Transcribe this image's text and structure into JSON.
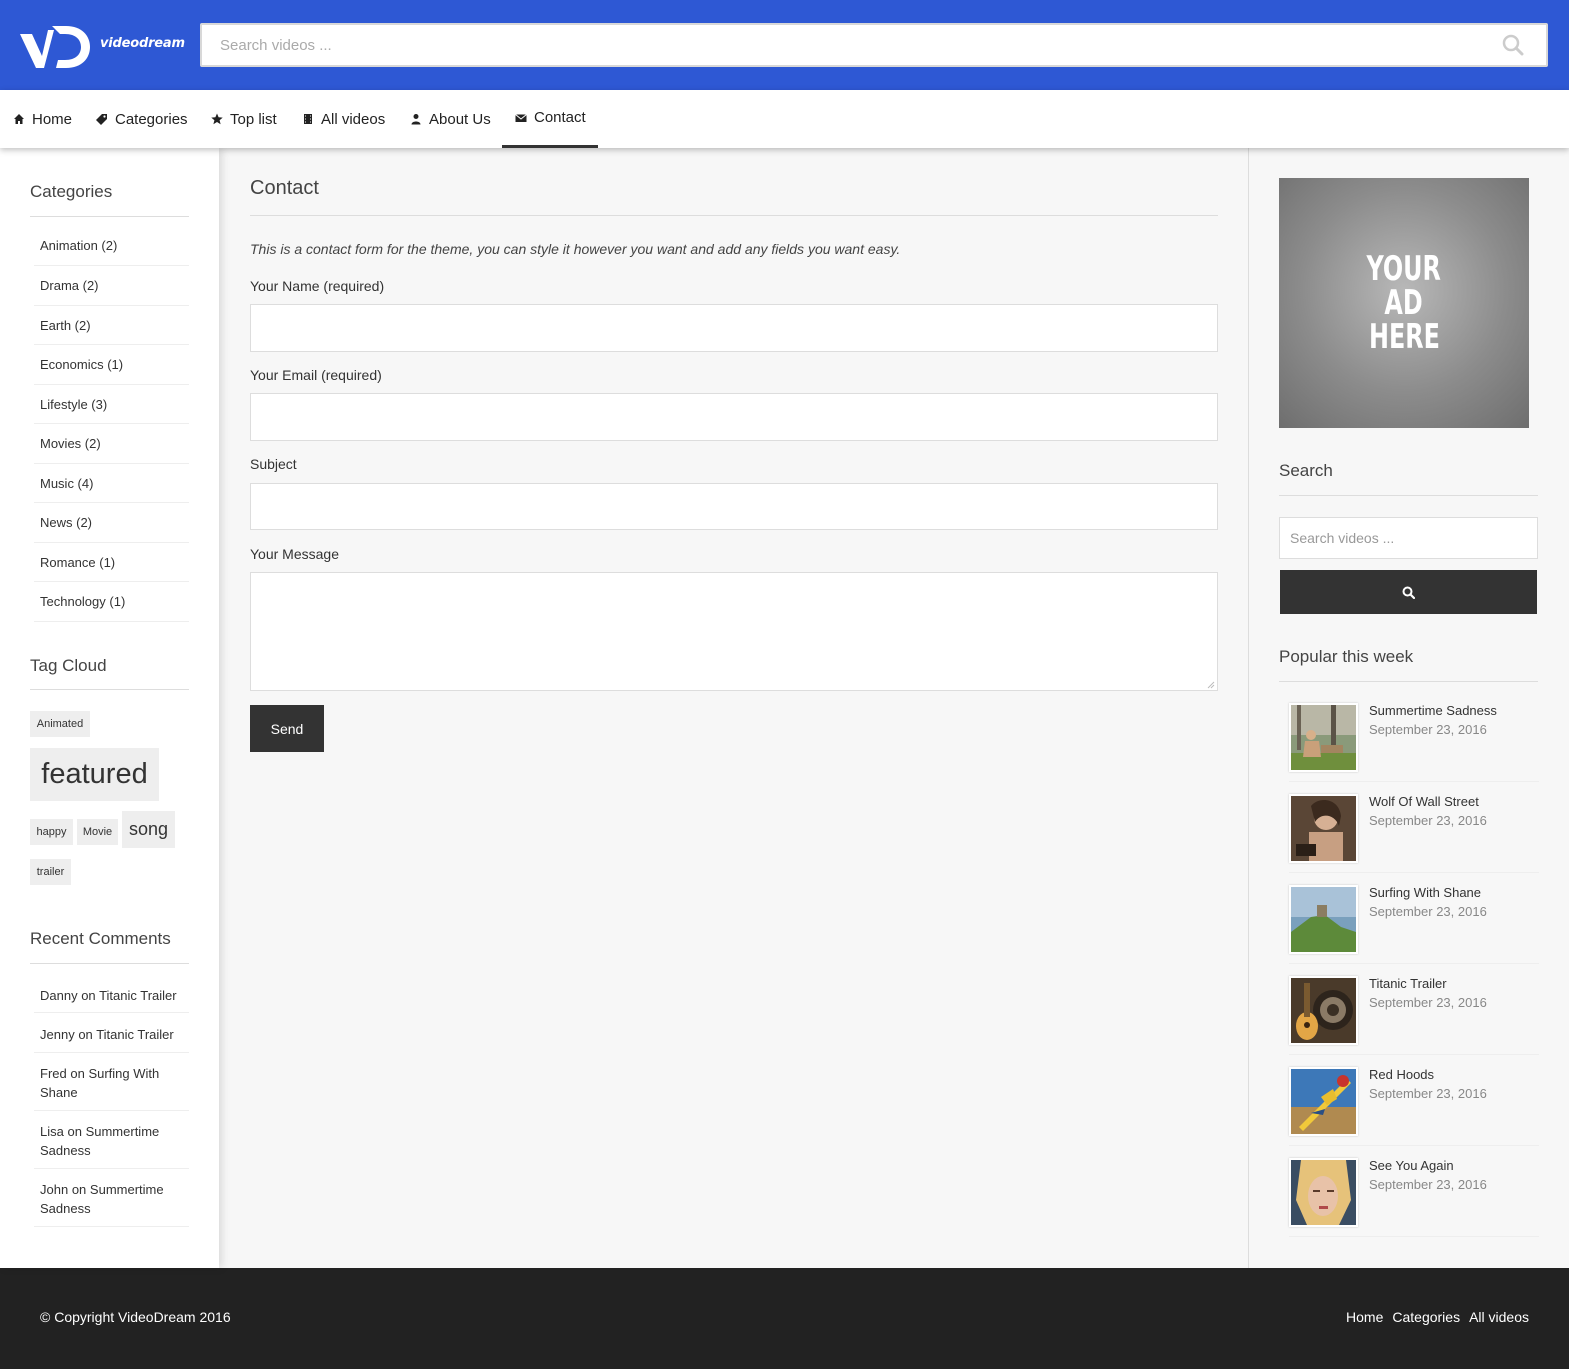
{
  "header": {
    "brand": "videodream",
    "search_placeholder": "Search videos ..."
  },
  "nav": [
    {
      "label": "Home",
      "icon": "home-icon"
    },
    {
      "label": "Categories",
      "icon": "tag-icon"
    },
    {
      "label": "Top list",
      "icon": "star-icon"
    },
    {
      "label": "All videos",
      "icon": "film-icon"
    },
    {
      "label": "About Us",
      "icon": "user-icon"
    },
    {
      "label": "Contact",
      "icon": "envelope-icon",
      "active": true
    }
  ],
  "left_sidebar": {
    "categories_title": "Categories",
    "categories": [
      "Animation (2)",
      "Drama (2)",
      "Earth (2)",
      "Economics (1)",
      "Lifestyle (3)",
      "Movies (2)",
      "Music (4)",
      "News (2)",
      "Romance (1)",
      "Technology (1)"
    ],
    "tag_cloud_title": "Tag Cloud",
    "tags": [
      "Animated",
      "featured",
      "happy",
      "Movie",
      "song",
      "trailer"
    ],
    "recent_comments_title": "Recent Comments",
    "recent_comments": [
      {
        "author": "Danny",
        "on": "on",
        "post": "Titanic Trailer"
      },
      {
        "author": "Jenny",
        "on": "on",
        "post": "Titanic Trailer"
      },
      {
        "author": "Fred",
        "on": "on",
        "post": "Surfing With Shane"
      },
      {
        "author": "Lisa",
        "on": "on",
        "post": "Summertime Sadness"
      },
      {
        "author": "John",
        "on": "on",
        "post": "Summertime Sadness"
      }
    ]
  },
  "main": {
    "title": "Contact",
    "intro": "This is a contact form for the theme, you can style it however you want and add any fields you want easy.",
    "name_label": "Your Name (required)",
    "email_label": "Your Email (required)",
    "subject_label": "Subject",
    "message_label": "Your Message",
    "send_label": "Send"
  },
  "right_sidebar": {
    "ad_lines": [
      "YOUR",
      "AD",
      "HERE"
    ],
    "search_title": "Search",
    "search_placeholder": "Search videos ...",
    "popular_title": "Popular this week",
    "popular": [
      {
        "title": "Summertime Sadness",
        "date": "September 23, 2016"
      },
      {
        "title": "Wolf Of Wall Street",
        "date": "September 23, 2016"
      },
      {
        "title": "Surfing With Shane",
        "date": "September 23, 2016"
      },
      {
        "title": "Titanic Trailer",
        "date": "September 23, 2016"
      },
      {
        "title": "Red Hoods",
        "date": "September 23, 2016"
      },
      {
        "title": "See You Again",
        "date": "September 23, 2016"
      }
    ]
  },
  "footer": {
    "copyright": "© Copyright VideoDream 2016",
    "links": [
      "Home",
      "Categories",
      "All videos"
    ]
  },
  "colors": {
    "header_bg": "#2e58d4",
    "dark": "#333333",
    "footer_bg": "#222222"
  }
}
